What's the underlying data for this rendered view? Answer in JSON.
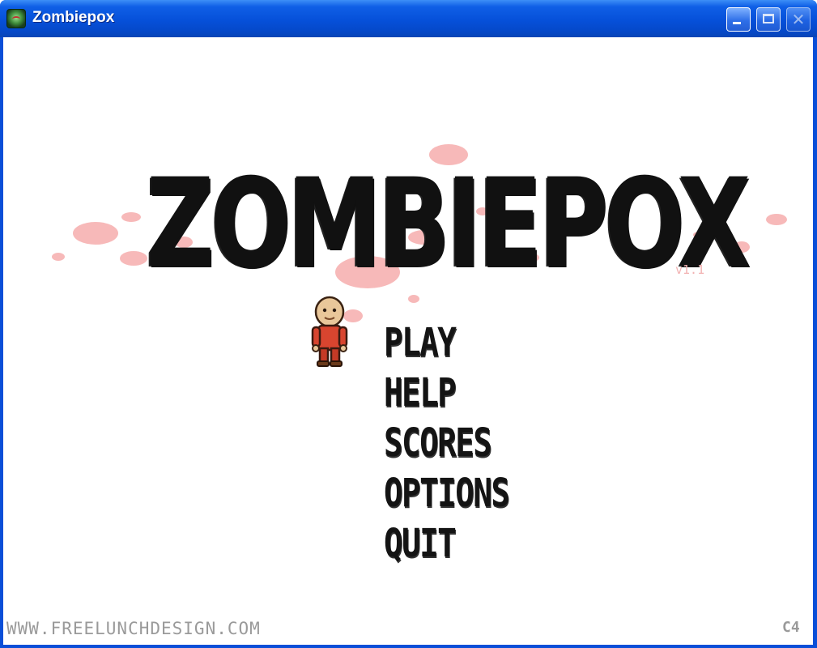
{
  "window": {
    "title": "Zombiepox",
    "icon": "zombie-head-icon",
    "controls": {
      "minimize": "minimize-icon",
      "maximize": "maximize-icon",
      "close": "close-icon",
      "close_glyph": "✕"
    }
  },
  "game": {
    "logo": "ZOMBIEPOX",
    "version": "v1.1",
    "menu": [
      "PLAY",
      "HELP",
      "SCORES",
      "OPTIONS",
      "QUIT"
    ],
    "selected_index": 0,
    "cursor": "player-character-sprite",
    "footer_url": "WWW.FREELUNCHDESIGN.COM",
    "footer_mark": "C4"
  },
  "colors": {
    "titlebar": "#0650d9",
    "background": "#ffffff",
    "logo": "#111111",
    "blood": "#f7b9b9",
    "version": "#f2b2b2",
    "footer": "#9a9a9a"
  }
}
